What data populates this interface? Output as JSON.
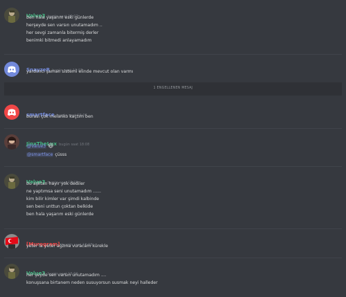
{
  "messages": [
    {
      "author": "Value3",
      "time": "bugün saat 18:07",
      "color": "#43b581",
      "lines": [
        "ben hala yaşarım eski günlerde",
        "herşeyde sen varsın unutamadım ..",
        "her sevgi zamanla bitermiş derler",
        "benimki bitmedi anlayamadım"
      ]
    },
    {
      "author": "SnayzeR",
      "time": "bugün saat 18:07",
      "color": "#7289da",
      "lines": [
        "yardımcı şaman sistemi elinde mevcut olan varmı"
      ]
    },
    {
      "author": "smartface",
      "time": "bugün saat 18:07",
      "color": "#7289da",
      "lines": [
        "burası çok melanko kaçtım ben"
      ]
    },
    {
      "author": "JinxTheLux",
      "time": "bugün saat 18:08",
      "color": "#43b581",
      "mention1": "@Value3",
      "emoji": "😆",
      "mention2": "@smartface",
      "line2_rest": "çüsss"
    },
    {
      "author": "Value3",
      "time": "bugün saat 18:08",
      "color": "#43b581",
      "lines": [
        "bu aşktan  hayır yok dediler",
        "ne yaptımsa seni unutamadım ......",
        "kim bilir kimler var şimdi kalbinde",
        "sen beni unttun çoktan belkide",
        "ben hala yaşarım eski günlerde"
      ]
    },
    {
      "author": "[Murogram]",
      "time": "bugün saat 18:08",
      "color": "#f04747",
      "lines": [
        "yeter la yeter ağzına vuracam kürekle"
      ]
    },
    {
      "author": "Value3",
      "time": "bugün saat 18:09",
      "color": "#43b581",
      "lines": [
        "her şeyde  sen varsın unutamadım ....",
        "konuşsana birtanem neden susuyorsun susmak neyi halleder"
      ]
    }
  ],
  "blocked_divider": "1 ENGELLENEN MESAJ",
  "colors": {
    "background": "#36393f",
    "blurple": "#7289da",
    "red": "#f04747",
    "green": "#43b581"
  }
}
